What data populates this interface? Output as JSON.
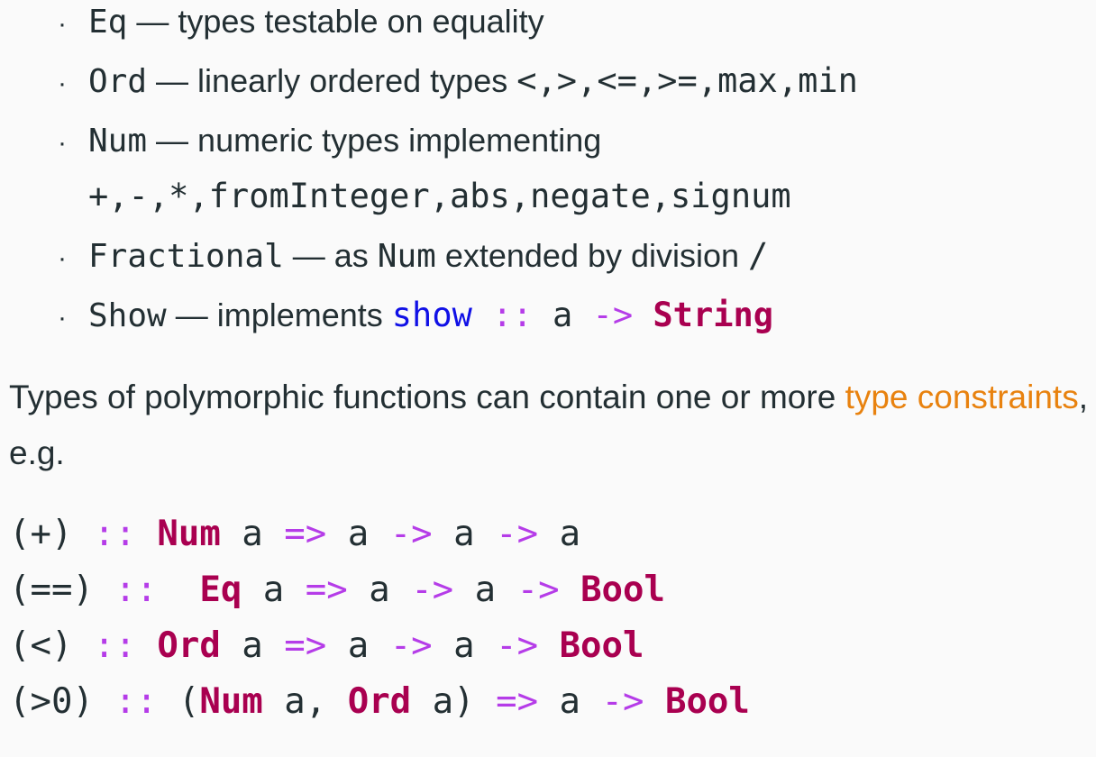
{
  "bullets": [
    {
      "name": "Eq",
      "dash": " — ",
      "desc": "types testable on equality"
    },
    {
      "name": "Ord",
      "dash": " — ",
      "desc": "linearly ordered types ",
      "code": "<,>,<=,>=,max,min"
    },
    {
      "name": "Num",
      "dash": " — ",
      "desc": "numeric types implementing",
      "continuation": "+,-,*,fromInteger,abs,negate,signum"
    },
    {
      "name": "Fractional",
      "dash": " — ",
      "desc_pre": "as ",
      "inline_type": "Num",
      "desc_post": " extended by division ",
      "code": "/"
    },
    {
      "name": "Show",
      "dash": " — ",
      "desc": "implements ",
      "sig": {
        "fn": "show",
        "colons": " :: ",
        "arg": "a",
        "arrow": " -> ",
        "ret": "String"
      }
    }
  ],
  "bullet_symbol": "·",
  "paragraph": {
    "text_before": "Types of polymorphic functions can contain one or more ",
    "highlight": "type constraints",
    "text_after": ", e.g."
  },
  "code_lines": [
    [
      {
        "t": "(+) ",
        "c": "pl"
      },
      {
        "t": ":: ",
        "c": "op"
      },
      {
        "t": "Num",
        "c": "kw"
      },
      {
        "t": " a ",
        "c": "pl"
      },
      {
        "t": "=>",
        "c": "op"
      },
      {
        "t": " a ",
        "c": "pl"
      },
      {
        "t": "->",
        "c": "op"
      },
      {
        "t": " a ",
        "c": "pl"
      },
      {
        "t": "->",
        "c": "op"
      },
      {
        "t": " a",
        "c": "pl"
      }
    ],
    [
      {
        "t": "(==) ",
        "c": "pl"
      },
      {
        "t": ":: ",
        "c": "op"
      },
      {
        "t": " Eq",
        "c": "kw"
      },
      {
        "t": " a ",
        "c": "pl"
      },
      {
        "t": "=>",
        "c": "op"
      },
      {
        "t": " a ",
        "c": "pl"
      },
      {
        "t": "->",
        "c": "op"
      },
      {
        "t": " a ",
        "c": "pl"
      },
      {
        "t": "->",
        "c": "op"
      },
      {
        "t": " ",
        "c": "pl"
      },
      {
        "t": "Bool",
        "c": "kw"
      }
    ],
    [
      {
        "t": "(<) ",
        "c": "pl"
      },
      {
        "t": ":: ",
        "c": "op"
      },
      {
        "t": "Ord",
        "c": "kw"
      },
      {
        "t": " a ",
        "c": "pl"
      },
      {
        "t": "=>",
        "c": "op"
      },
      {
        "t": " a ",
        "c": "pl"
      },
      {
        "t": "->",
        "c": "op"
      },
      {
        "t": " a ",
        "c": "pl"
      },
      {
        "t": "->",
        "c": "op"
      },
      {
        "t": " ",
        "c": "pl"
      },
      {
        "t": "Bool",
        "c": "kw"
      }
    ],
    [
      {
        "t": "(>0) ",
        "c": "pl"
      },
      {
        "t": ":: ",
        "c": "op"
      },
      {
        "t": "(",
        "c": "pl"
      },
      {
        "t": "Num",
        "c": "kw"
      },
      {
        "t": " a, ",
        "c": "pl"
      },
      {
        "t": "Ord",
        "c": "kw"
      },
      {
        "t": " a) ",
        "c": "pl"
      },
      {
        "t": "=>",
        "c": "op"
      },
      {
        "t": " a ",
        "c": "pl"
      },
      {
        "t": "->",
        "c": "op"
      },
      {
        "t": " ",
        "c": "pl"
      },
      {
        "t": "Bool",
        "c": "kw"
      }
    ]
  ],
  "colors": {
    "text": "#232f33",
    "keyword": "#a90050",
    "operator": "#b53ce8",
    "function": "#1010e6",
    "highlight": "#e8820f",
    "background": "#fafafa"
  }
}
